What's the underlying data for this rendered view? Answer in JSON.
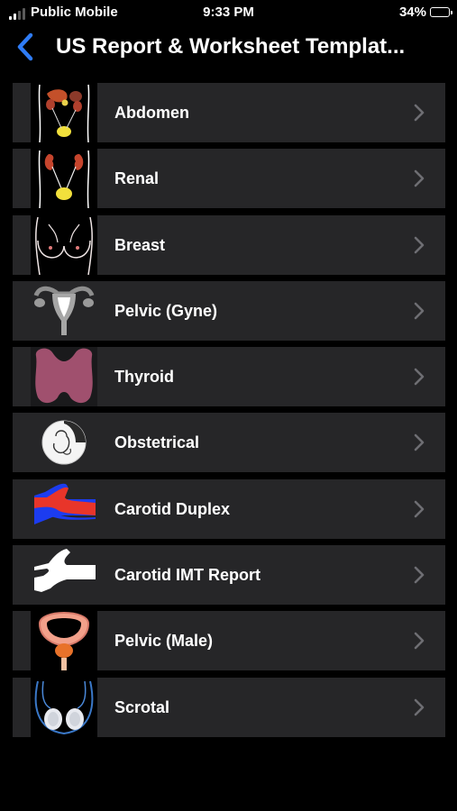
{
  "status_bar": {
    "carrier": "Public Mobile",
    "time": "9:33 PM",
    "battery": "34%",
    "battery_level": 0.34
  },
  "nav": {
    "title": "US Report & Worksheet Templat..."
  },
  "items": [
    {
      "label": "Abdomen",
      "icon": "abdomen-icon"
    },
    {
      "label": "Renal",
      "icon": "kidney-icon"
    },
    {
      "label": "Breast",
      "icon": "breast-icon"
    },
    {
      "label": "Pelvic (Gyne)",
      "icon": "uterus-icon"
    },
    {
      "label": "Thyroid",
      "icon": "thyroid-icon"
    },
    {
      "label": "Obstetrical",
      "icon": "fetus-icon"
    },
    {
      "label": "Carotid Duplex",
      "icon": "carotid-duplex-icon"
    },
    {
      "label": "Carotid IMT Report",
      "icon": "carotid-imt-icon"
    },
    {
      "label": "Pelvic (Male)",
      "icon": "prostate-icon"
    },
    {
      "label": "Scrotal",
      "icon": "scrotum-icon"
    }
  ],
  "colors": {
    "accent": "#2f7cf6",
    "row_bg": "#262628",
    "chevron": "#6e6e73"
  }
}
